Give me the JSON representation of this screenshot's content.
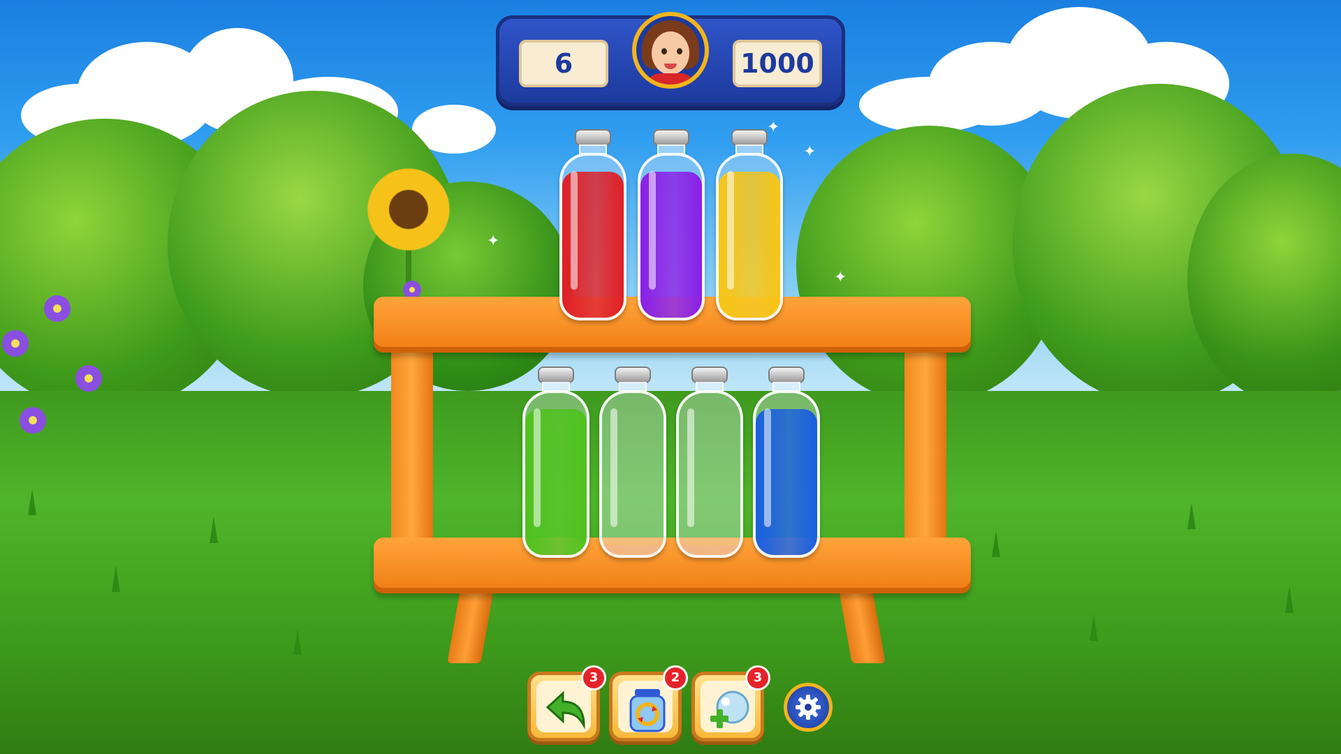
{
  "hud": {
    "moves": "6",
    "coins": "1000",
    "avatar": "player-avatar"
  },
  "shelves": {
    "top": [
      {
        "color": "#e01f25",
        "fill": 0.9
      },
      {
        "color": "#8a1fe6",
        "fill": 0.9
      },
      {
        "color": "#f7c515",
        "fill": 0.9
      }
    ],
    "bottom": [
      {
        "color": "#4fc21e",
        "fill": 0.9
      },
      {
        "color": "#f3b787",
        "fill": 0.06
      },
      {
        "color": "#f3b787",
        "fill": 0.06
      },
      {
        "color": "#1a5fe0",
        "fill": 0.9
      }
    ]
  },
  "toolbar": {
    "undo": {
      "icon": "undo-arrow-icon",
      "count": "3"
    },
    "shuffle": {
      "icon": "shuffle-jar-icon",
      "count": "2"
    },
    "add_bottle": {
      "icon": "add-bottle-icon",
      "count": "3"
    },
    "settings": {
      "icon": "gear-icon"
    }
  },
  "colors": {
    "hud_blue": "#1d3a9e",
    "wood": "#f08a1c",
    "badge_red": "#e5232a"
  }
}
